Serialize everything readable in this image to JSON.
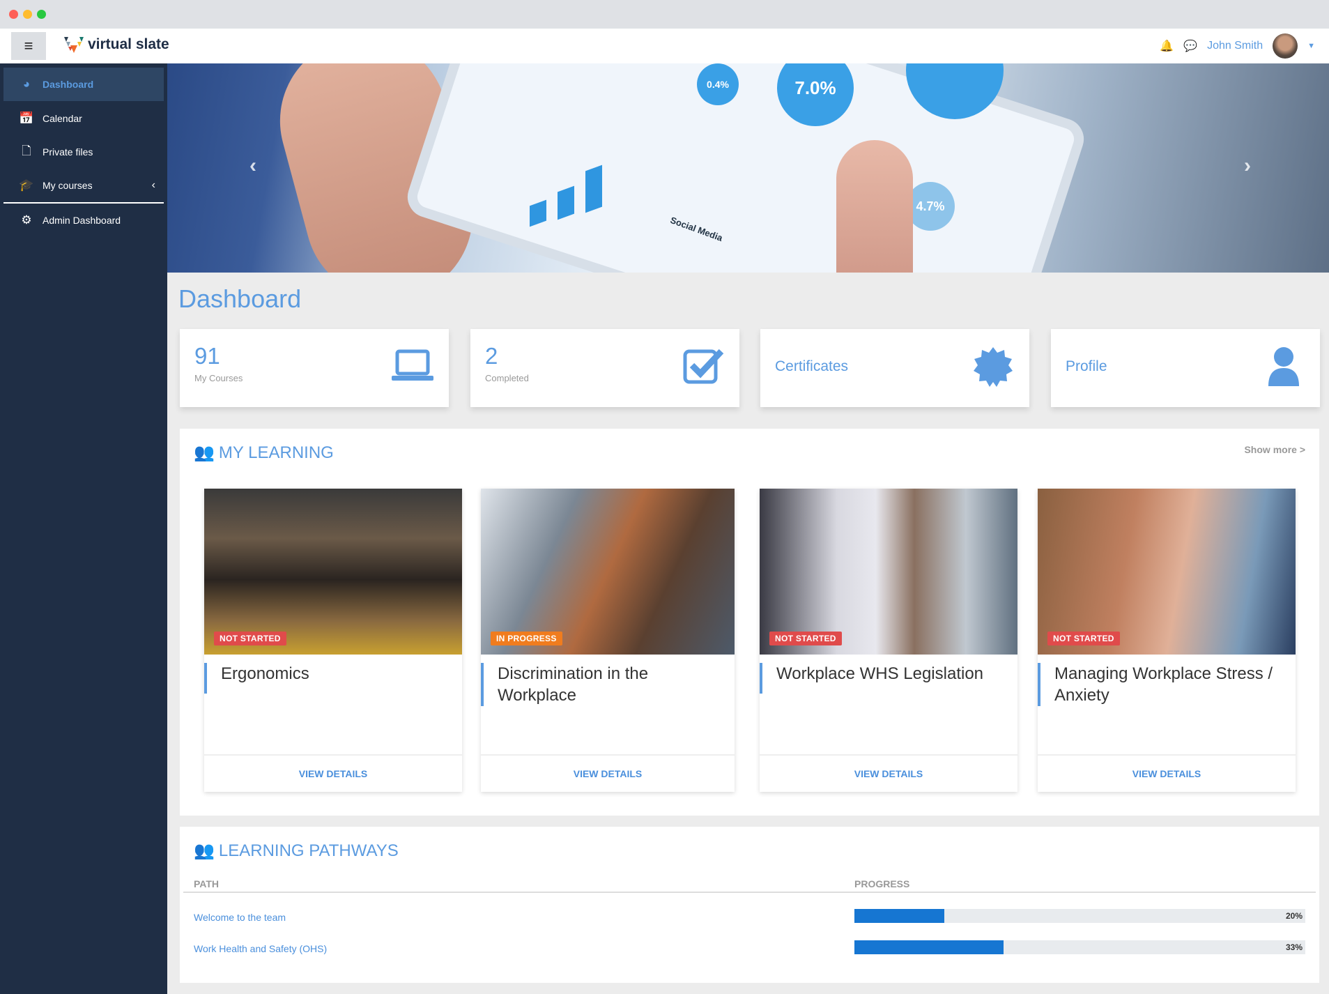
{
  "window": {
    "controls": [
      "close",
      "minimize",
      "maximize"
    ]
  },
  "navbar": {
    "brand": "virtual slate",
    "user_name": "John Smith",
    "icons": [
      "menu-icon",
      "bell-icon",
      "chat-icon",
      "caret-down-icon"
    ]
  },
  "sidebar": {
    "items": [
      {
        "label": "Dashboard",
        "icon": "dashboard-icon",
        "active": true
      },
      {
        "label": "Calendar",
        "icon": "calendar-icon"
      },
      {
        "label": "Private files",
        "icon": "file-icon"
      },
      {
        "label": "My courses",
        "icon": "graduation-cap-icon"
      },
      {
        "label": "Admin Dashboard",
        "icon": "cogs-icon"
      }
    ]
  },
  "hero": {
    "bubbles": [
      "0.4%",
      "7.0%",
      "4.7%"
    ],
    "caption": "Social Media"
  },
  "page": {
    "title": "Dashboard"
  },
  "stats": [
    {
      "value": "91",
      "label": "My Courses",
      "icon": "laptop-icon"
    },
    {
      "value": "2",
      "label": "Completed",
      "icon": "checkbox-icon"
    },
    {
      "label": "Certificates",
      "icon": "certificate-icon"
    },
    {
      "label": "Profile",
      "icon": "user-icon"
    }
  ],
  "my_learning": {
    "title": "MY LEARNING",
    "show_more": "Show more >",
    "courses": [
      {
        "title": "Ergonomics",
        "status": "NOT STARTED",
        "action": "VIEW DETAILS"
      },
      {
        "title": "Discrimination in the Workplace",
        "status": "IN PROGRESS",
        "action": "VIEW DETAILS"
      },
      {
        "title": "Workplace WHS Legislation",
        "status": "NOT STARTED",
        "action": "VIEW DETAILS"
      },
      {
        "title": "Managing Workplace Stress / Anxiety",
        "status": "NOT STARTED",
        "action": "VIEW DETAILS"
      }
    ]
  },
  "pathways": {
    "title": "LEARNING PATHWAYS",
    "col_path": "PATH",
    "col_progress": "PROGRESS",
    "rows": [
      {
        "path": "Welcome to the team",
        "progress": 20,
        "progress_label": "20%"
      },
      {
        "path": "Work Health and Safety (OHS)",
        "progress": 33,
        "progress_label": "33%"
      }
    ]
  },
  "colors": {
    "accent": "#5b9be0",
    "sidebar": "#1f2e45",
    "not_started": "#e04b4b",
    "in_progress": "#f07c1e",
    "progress": "#1676d2"
  }
}
